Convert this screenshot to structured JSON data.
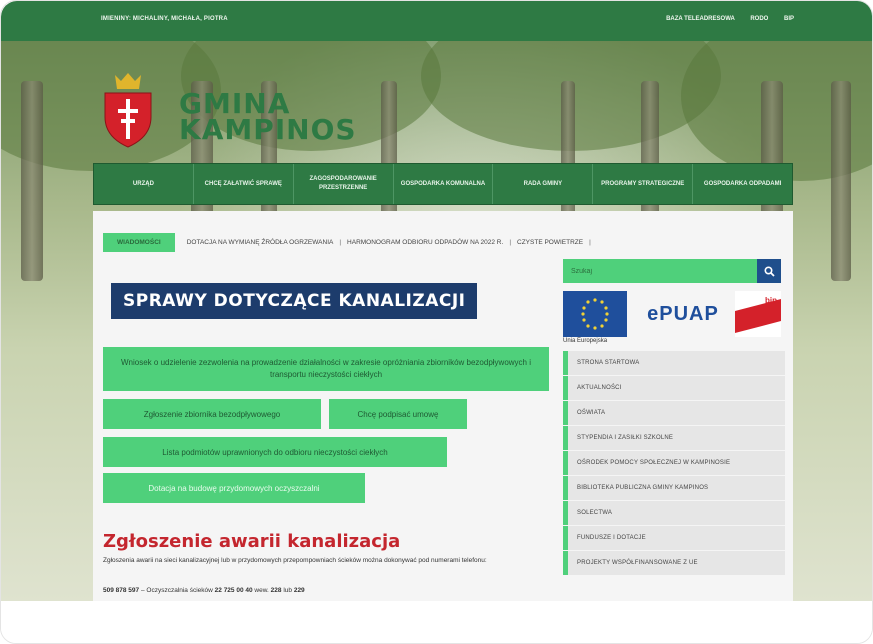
{
  "topbar": {
    "left_text": "IMIENINY: MICHALINY, MICHAŁA, PIOTRA",
    "links": [
      "BAZA TELEADRESOWA",
      "RODO",
      "BIP"
    ]
  },
  "brand": {
    "line1": "GMINA",
    "line2": "KAMPINOS"
  },
  "nav": [
    "URZĄD",
    "CHCĘ ZAŁATWIĆ SPRAWĘ",
    "ZAGOSPODAROWANIE PRZESTRZENNE",
    "GOSPODARKA KOMUNALNA",
    "RADA GMINY",
    "PROGRAMY STRATEGICZNE",
    "GOSPODARKA ODPADAMI"
  ],
  "ticker": {
    "badge": "WIADOMOŚCI",
    "items": [
      "DOTACJA NA WYMIANĘ ŹRÓDŁA OGRZEWANIA",
      "HARMONOGRAM ODBIORU ODPADÓW NA 2022 R.",
      "CZYSTE POWIETRZE"
    ]
  },
  "search": {
    "placeholder": "Szukaj"
  },
  "partners": {
    "eu_label": "Unia Europejska",
    "epuap": "ePUAP",
    "bip": "bip"
  },
  "side_menu": [
    "STRONA STARTOWA",
    "AKTUALNOŚCI",
    "OŚWIATA",
    "STYPENDIA I ZASIŁKI SZKOLNE",
    "OŚRODEK POMOCY SPOŁECZNEJ W KAMPINOSIE",
    "BIBLIOTEKA PUBLICZNA GMINY KAMPINOS",
    "SOLECTWA",
    "FUNDUSZE I DOTACJE",
    "PROJEKTY WSPÓŁFINANSOWANE Z UE"
  ],
  "main": {
    "title": "SPRAWY DOTYCZĄCE KANALIZACJI",
    "buttons": {
      "wniosek": "Wniosek o udzielenie zezwolenia na prowadzenie działalności w zakresie opróżniania zbiorników bezodpływowych i transportu nieczystości ciekłych",
      "zgloszenie": "Zgłoszenie zbiornika bezodpływowego",
      "umowa": "Chcę podpisać umowę",
      "lista": "Lista podmiotów uprawnionych do odbioru nieczystości ciekłych",
      "dotacja": "Dotacja na budowę przydomowych oczyszczalni"
    },
    "awaria_title": "Zgłoszenie awarii kanalizacja",
    "awaria_text": "Zgłoszenia awarii na sieci kanalizacyjnej lub w przydomowych przepompowniach ścieków można dokonywać pod numerami telefonu:",
    "phone1": "509 878 597",
    "phone_sep": " – Oczyszczalnia ścieków ",
    "phone2": "22 725 00 40",
    "phone_wew": " wew. ",
    "ext1": "228",
    "ext_or": " lub ",
    "ext2": "229"
  },
  "colors": {
    "green_dark": "#2e7a44",
    "green_light": "#4fd07b",
    "navy": "#1d3c6c",
    "red": "#c4262e"
  }
}
